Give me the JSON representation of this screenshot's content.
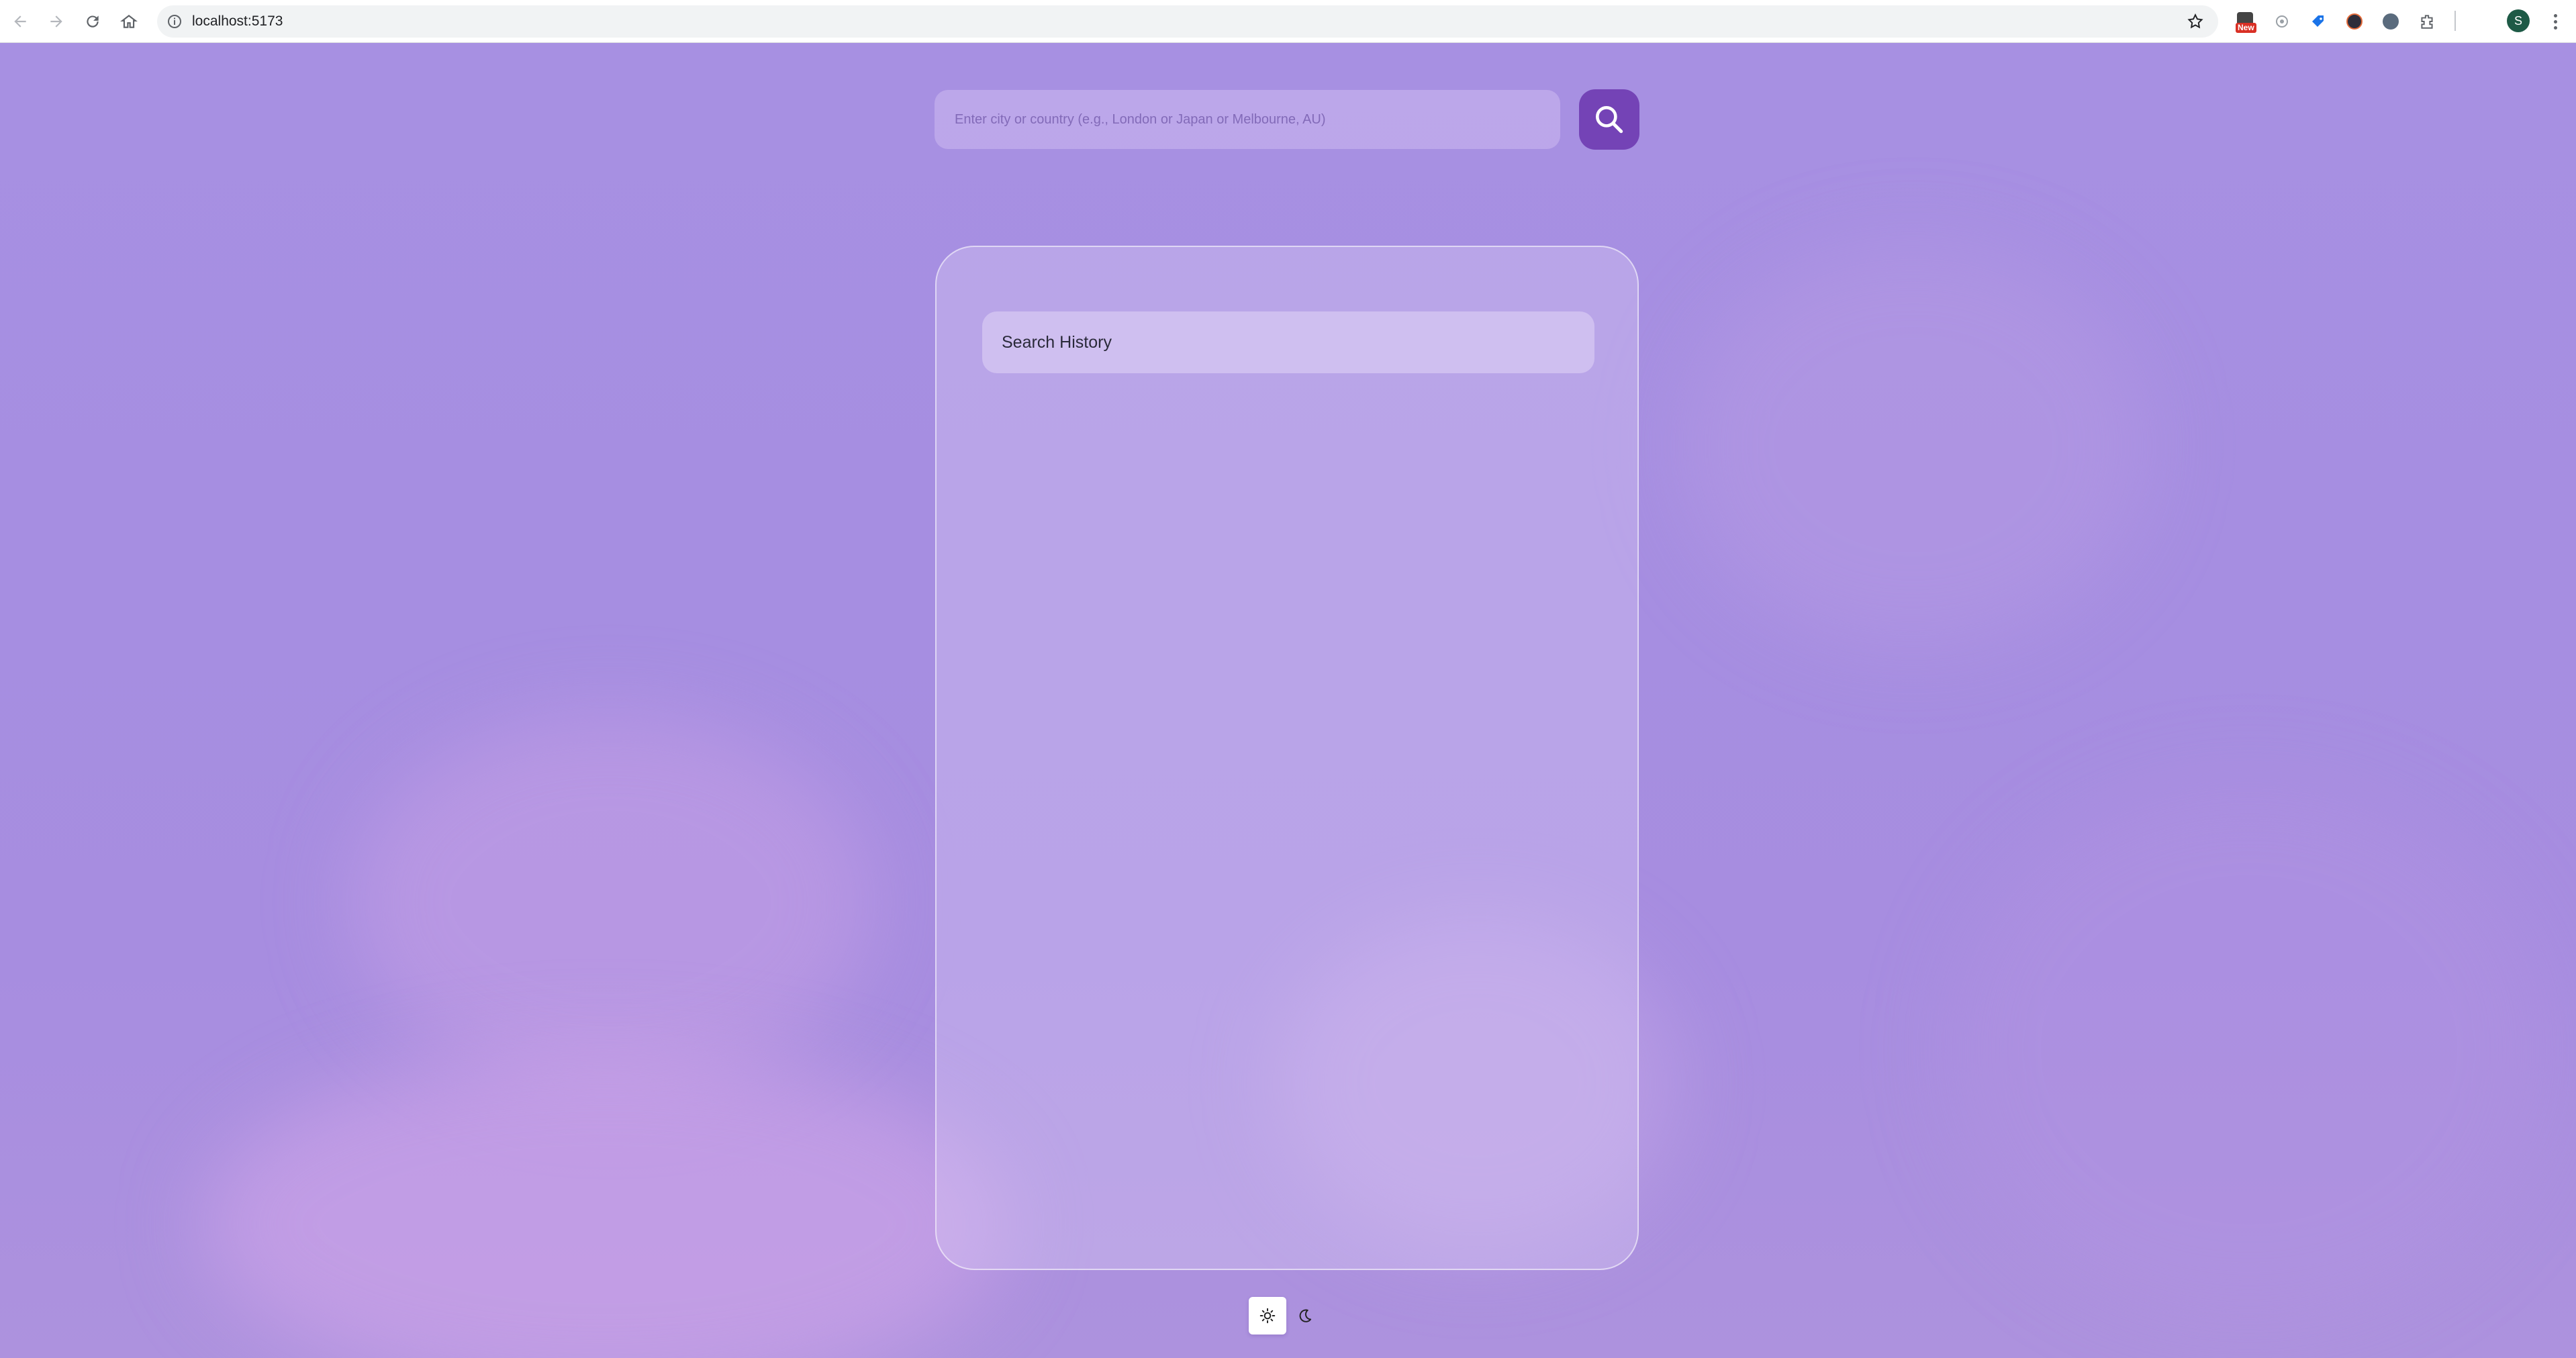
{
  "browser": {
    "url": "localhost:5173",
    "new_badge": "New",
    "profile_initial": "S"
  },
  "search": {
    "placeholder": "Enter city or country (e.g., London or Japan or Melbourne, AU)",
    "value": ""
  },
  "history": {
    "title": "Search History",
    "items": []
  },
  "theme": {
    "selected": "light",
    "options": [
      "light",
      "dark"
    ]
  },
  "colors": {
    "accent": "#7443b6",
    "background": "#a68ee1"
  }
}
